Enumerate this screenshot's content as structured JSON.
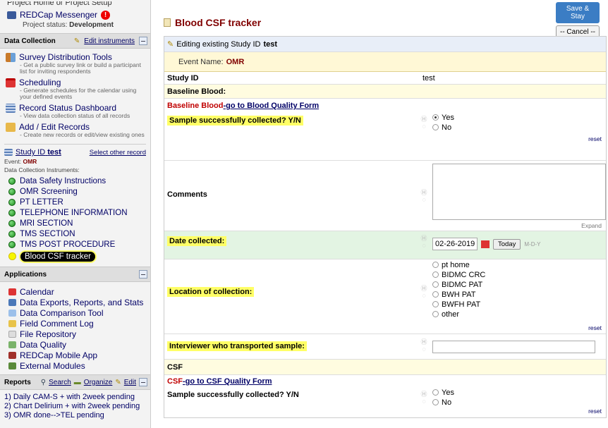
{
  "sidebar": {
    "top_cut_text": "Project Home or Project Setup",
    "messenger_label": "REDCap Messenger",
    "project_status_label": "Project status:",
    "project_status_value": "Development",
    "data_collection": {
      "title": "Data Collection",
      "edit_instruments": "Edit instruments",
      "tools": [
        {
          "label": "Survey Distribution Tools",
          "desc": "- Get a public survey link or build a participant list for inviting respondents"
        },
        {
          "label": "Scheduling",
          "desc": "- Generate schedules for the calendar using your defined events"
        },
        {
          "label": "Record Status Dashboard",
          "desc": "- View data collection status of all records"
        },
        {
          "label": "Add / Edit Records",
          "desc": "- Create new records or edit/view existing ones"
        }
      ],
      "record_label": "Study ID",
      "record_value": "test",
      "select_other": "Select other record",
      "event_label": "Event:",
      "event_value": "OMR",
      "instruments_label": "Data Collection Instruments:",
      "instruments": [
        "Data Safety Instructions",
        "OMR Screening",
        "PT LETTER",
        "TELEPHONE INFORMATION",
        "MRI SECTION",
        "TMS SECTION",
        "TMS POST PROCEDURE",
        "Blood CSF tracker"
      ]
    },
    "applications": {
      "title": "Applications",
      "items": [
        "Calendar",
        "Data Exports, Reports, and Stats",
        "Data Comparison Tool",
        "Field Comment Log",
        "File Repository",
        "Data Quality",
        "REDCap Mobile App",
        "External Modules"
      ]
    },
    "reports": {
      "title": "Reports",
      "search": "Search",
      "organize": "Organize",
      "edit": "Edit",
      "items": [
        "1) Daily CAM-S + with 2week pending",
        "2) Chart Delirium + with 2week pending",
        "3) OMR done-->TEL pending"
      ]
    }
  },
  "main": {
    "form_title": "Blood CSF tracker",
    "save_stay": "Save & Stay",
    "cancel": "-- Cancel --",
    "editing_prefix": "Editing existing Study ID",
    "editing_value": "test",
    "event_name_label": "Event Name:",
    "event_name_value": "OMR",
    "study_id_label": "Study ID",
    "study_id_value": "test",
    "baseline_blood_header": "Baseline Blood:",
    "baseline_blood_red": "Baseline Blood",
    "baseline_blood_link": "-go to Blood Quality Form",
    "sample_q1": "Sample successfully collected? Y/N",
    "yes": "Yes",
    "no": "No",
    "reset": "reset",
    "comments_label": "Comments",
    "expand": "Expand",
    "date_label": "Date collected:",
    "date_value": "02-26-2019",
    "today_btn": "Today",
    "date_format": "M-D-Y",
    "location_label": "Location of collection:",
    "locations": [
      "pt home",
      "BIDMC CRC",
      "BIDMC PAT",
      "BWH PAT",
      "BWFH PAT",
      "other"
    ],
    "interviewer_label": "Interviewer who transported sample:",
    "csf_header": "CSF",
    "csf_red": "CSF",
    "csf_link": "-go to CSF Quality Form",
    "sample_q2": "Sample successfully collected? Y/N"
  },
  "colors": {
    "title": "#800000",
    "link": "#000066",
    "highlight": "#ffff66",
    "green": "#e3f4e3",
    "header_bg": "#fffce0",
    "accent_red": "#c00000",
    "button_blue": "#3b7dc4"
  }
}
